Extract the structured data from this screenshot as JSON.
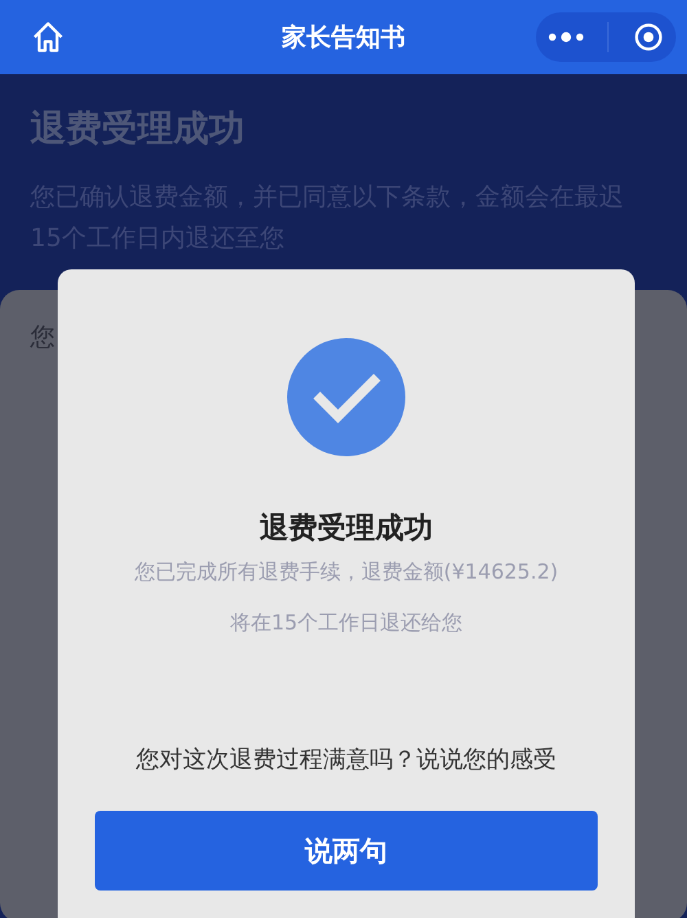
{
  "nav_bar": {
    "title": "家长告知书"
  },
  "page": {
    "heading": "退费受理成功",
    "description": "您已确认退费金额，并已同意以下条款，金额会在最迟15个工作日内退还至您",
    "card_text": "您"
  },
  "dialog": {
    "title": "退费受理成功",
    "message_lines": [
      "您已完成所有退费手续，退费金额(¥14625.2)",
      "将在15个工作日退还给您"
    ],
    "question": "您对这次退费过程满意吗？说说您的感受",
    "button": "说两句"
  }
}
